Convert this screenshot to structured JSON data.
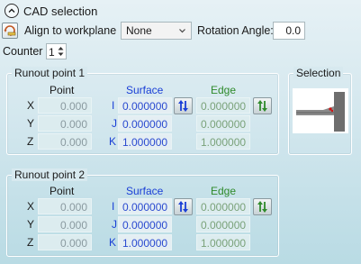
{
  "header": {
    "title": "CAD selection",
    "align_label": "Align to workplane",
    "align_value": "None",
    "rotation_label": "Rotation Angle:",
    "rotation_value": "0.0",
    "counter_label": "Counter",
    "counter_value": "1"
  },
  "columns": {
    "point": "Point",
    "surface": "Surface",
    "edge": "Edge"
  },
  "runout1": {
    "title": "Runout point 1",
    "rows": [
      {
        "axis": "X",
        "dir": "I",
        "point": "0.000",
        "surface": "0.000000",
        "edge": "0.000000"
      },
      {
        "axis": "Y",
        "dir": "J",
        "point": "0.000",
        "surface": "0.000000",
        "edge": "0.000000"
      },
      {
        "axis": "Z",
        "dir": "K",
        "point": "0.000",
        "surface": "1.000000",
        "edge": "1.000000"
      }
    ]
  },
  "runout2": {
    "title": "Runout point 2",
    "rows": [
      {
        "axis": "X",
        "dir": "I",
        "point": "0.000",
        "surface": "0.000000",
        "edge": "0.000000"
      },
      {
        "axis": "Y",
        "dir": "J",
        "point": "0.000",
        "surface": "0.000000",
        "edge": "0.000000"
      },
      {
        "axis": "Z",
        "dir": "K",
        "point": "0.000",
        "surface": "1.000000",
        "edge": "1.000000"
      }
    ]
  },
  "selection": {
    "title": "Selection"
  },
  "colors": {
    "surface": "#1a3fd6",
    "edge": "#2f8a2b"
  }
}
